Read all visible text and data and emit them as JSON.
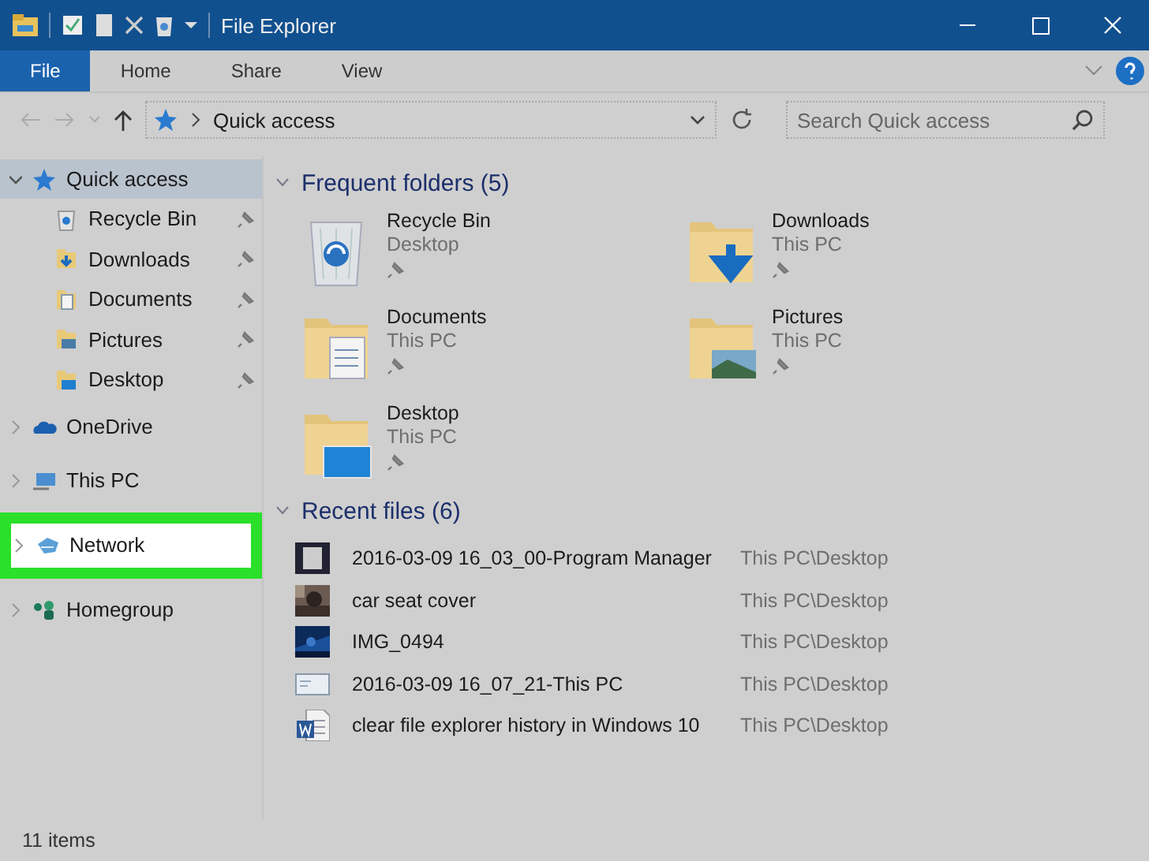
{
  "window": {
    "title": "File Explorer"
  },
  "ribbon": {
    "tabs": [
      {
        "label": "File",
        "kind": "file"
      },
      {
        "label": "Home",
        "kind": "tab"
      },
      {
        "label": "Share",
        "kind": "tab"
      },
      {
        "label": "View",
        "kind": "tab"
      }
    ]
  },
  "address": {
    "path": "Quick access"
  },
  "search": {
    "placeholder": "Search Quick access"
  },
  "sidebar": {
    "items": [
      {
        "label": "Quick access",
        "kind": "star",
        "expanded": true,
        "selected": true,
        "highlighted": false,
        "children": [
          {
            "label": "Recycle Bin",
            "kind": "bin",
            "pinned": true
          },
          {
            "label": "Downloads",
            "kind": "downloads",
            "pinned": true
          },
          {
            "label": "Documents",
            "kind": "documents",
            "pinned": true
          },
          {
            "label": "Pictures",
            "kind": "pictures",
            "pinned": true
          },
          {
            "label": "Desktop",
            "kind": "desktop",
            "pinned": true
          }
        ]
      },
      {
        "label": "OneDrive",
        "kind": "cloud",
        "expanded": false,
        "selected": false,
        "highlighted": false
      },
      {
        "label": "This PC",
        "kind": "pc",
        "expanded": false,
        "selected": false,
        "highlighted": false
      },
      {
        "label": "Network",
        "kind": "network",
        "expanded": false,
        "selected": false,
        "highlighted": true
      },
      {
        "label": "Homegroup",
        "kind": "homegroup",
        "expanded": false,
        "selected": false,
        "highlighted": false
      }
    ]
  },
  "frequent_folders": {
    "title": "Frequent folders (5)",
    "expanded": true,
    "items": [
      {
        "name": "Recycle Bin",
        "location": "Desktop",
        "kind": "bin",
        "pinned": true
      },
      {
        "name": "Downloads",
        "location": "This PC",
        "kind": "downloads",
        "pinned": true
      },
      {
        "name": "Documents",
        "location": "This PC",
        "kind": "documents",
        "pinned": true
      },
      {
        "name": "Pictures",
        "location": "This PC",
        "kind": "pictures",
        "pinned": true
      },
      {
        "name": "Desktop",
        "location": "This PC",
        "kind": "desktop",
        "pinned": true
      }
    ]
  },
  "recent_files": {
    "title": "Recent files (6)",
    "expanded": true,
    "items": [
      {
        "name": "2016-03-09 16_03_00-Program Manager",
        "location": "This PC\\Desktop",
        "kind": "screenshot"
      },
      {
        "name": "car seat cover",
        "location": "This PC\\Desktop"
      },
      {
        "name": "IMG_0494",
        "location": "This PC\\Desktop"
      },
      {
        "name": "2016-03-09 16_07_21-This PC",
        "location": "This PC\\Desktop",
        "kind": "screenshot"
      },
      {
        "name": "clear file explorer history in Windows 10",
        "location": "This PC\\Desktop",
        "kind": "document"
      }
    ]
  },
  "status_bar": {
    "count": "11 items"
  }
}
